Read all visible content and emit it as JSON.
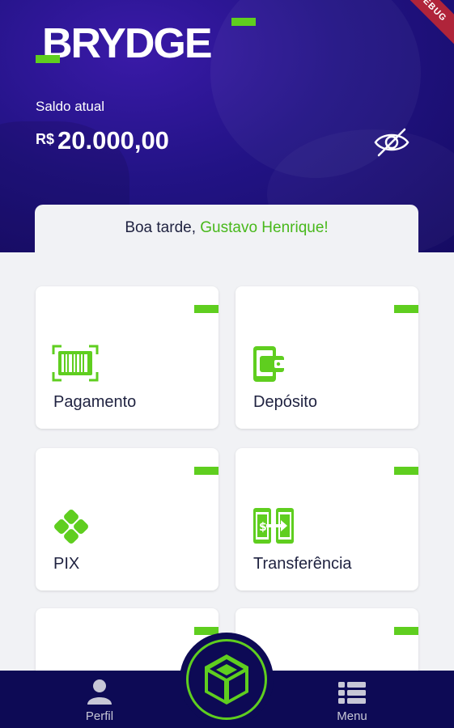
{
  "app": {
    "logo_text": "BRYDGE",
    "debug_banner": "DEBUG"
  },
  "balance": {
    "label": "Saldo atual",
    "currency": "R$",
    "value": "20.000,00",
    "toggle_icon": "eye-off-icon"
  },
  "greeting": {
    "prefix": "Boa tarde, ",
    "name": "Gustavo Henrique!"
  },
  "actions": [
    {
      "label": "Pagamento",
      "icon": "barcode-payment-icon"
    },
    {
      "label": "Depósito",
      "icon": "wallet-phone-icon"
    },
    {
      "label": "PIX",
      "icon": "pix-icon"
    },
    {
      "label": "Transferência",
      "icon": "transfer-phone-icon"
    },
    {
      "label": "",
      "icon": ""
    },
    {
      "label": "",
      "icon": ""
    }
  ],
  "nav": {
    "profile_label": "Perfil",
    "menu_label": "Menu",
    "center_icon": "cube-icon"
  },
  "colors": {
    "accent_green": "#5fce1f",
    "header_purple": "#221385",
    "nav_navy": "#0d0a55"
  }
}
